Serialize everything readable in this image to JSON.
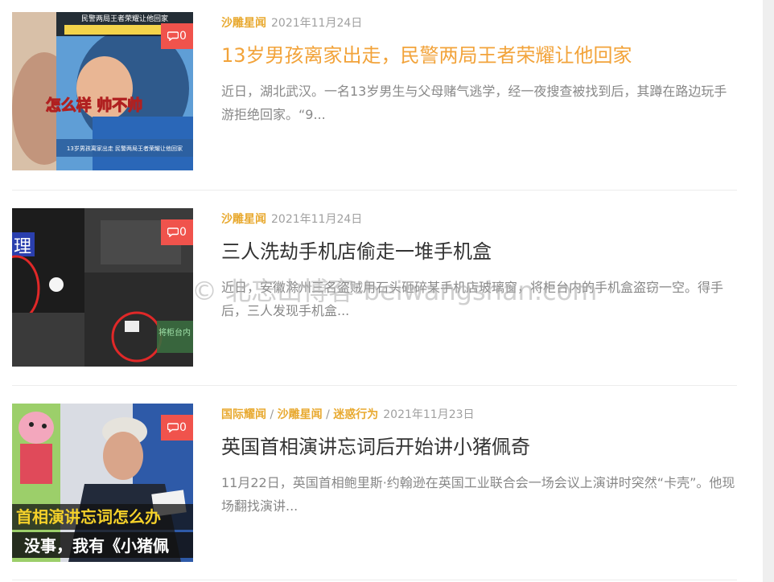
{
  "posts": [
    {
      "categories": [
        "沙雕星闻"
      ],
      "date": "2021年11月24日",
      "title": "13岁男孩离家出走，民警两局王者荣耀让他回家",
      "excerpt": "近日，湖北武汉。一名13岁男生与父母赌气逃学，经一夜搜查被找到后，其蹲在路边玩手游拒绝回家。“9...",
      "comments": "0",
      "thumb_caption_top": "民警两局王者荣耀让他回家",
      "thumb_caption_mid": "怎么样 帅不帅",
      "thumb_caption_bottom": "13岁男孩离家出走 民警两局王者荣耀让他回家",
      "highlighted": true
    },
    {
      "categories": [
        "沙雕星闻"
      ],
      "date": "2021年11月24日",
      "title": "三人洗劫手机店偷走一堆手机盒",
      "excerpt": "近日，安徽滁州三名盗贼用石头砸碎某手机店玻璃窗，将柜台内的手机盒盗窃一空。得手后，三人发现手机盒...",
      "comments": "0",
      "thumb_caption": "将柜台内 全部盗窃",
      "highlighted": false
    },
    {
      "categories": [
        "国际耀闻",
        "沙雕星闻",
        "迷惑行为"
      ],
      "date": "2021年11月23日",
      "title": "英国首相演讲忘词后开始讲小猪佩奇",
      "excerpt": "11月22日，英国首相鲍里斯·约翰逊在英国工业联合会一场会议上演讲时突然“卡壳”。他现场翻找演讲...",
      "comments": "0",
      "thumb_caption_1": "首相演讲忘词怎么办",
      "thumb_caption_2": "没事，我有《小猪佩",
      "highlighted": false
    }
  ],
  "watermark": "© 北忘山博客-beiwangshan.com",
  "colors": {
    "category": "#e8a92f",
    "title_highlight": "#f2a33a",
    "badge": "#f0534c",
    "excerpt": "#888888"
  }
}
